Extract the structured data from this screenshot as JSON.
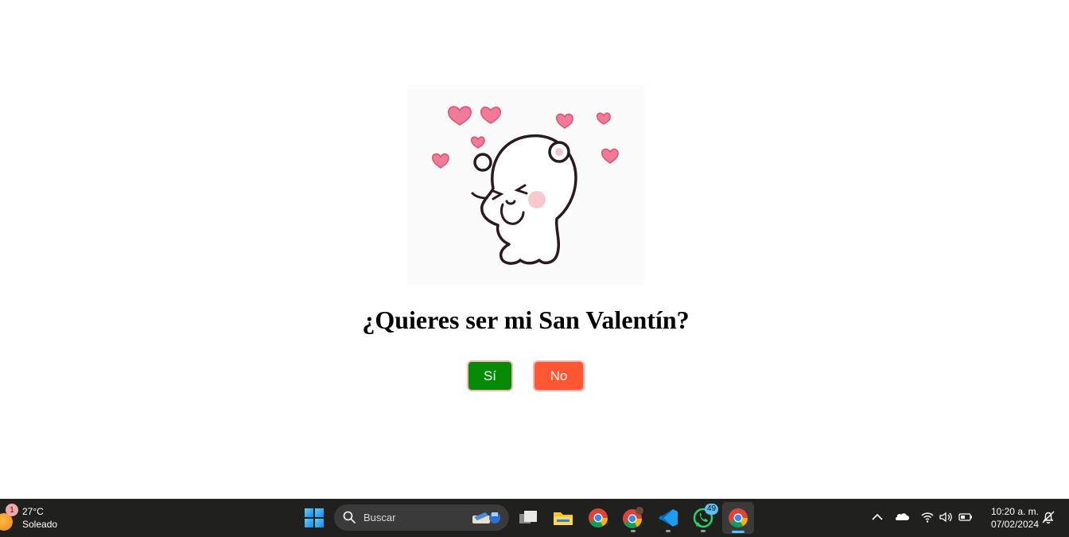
{
  "main": {
    "question": "¿Quieres ser mi San Valentín?",
    "yes_label": "Sí",
    "no_label": "No",
    "colors": {
      "yes": "#078b07",
      "no": "#ff5733"
    }
  },
  "taskbar": {
    "weather": {
      "badge": "1",
      "temp": "27°C",
      "condition": "Soleado"
    },
    "search_placeholder": "Buscar",
    "notification_count": "49",
    "time": "10:20 a. m.",
    "date": "07/02/2024",
    "icons": [
      "start-icon",
      "task-view-icon",
      "file-explorer-icon",
      "chrome-icon",
      "chrome-profile-icon",
      "vscode-icon",
      "whatsapp-icon",
      "chrome-active-icon"
    ],
    "tray": [
      "chevron-up-icon",
      "onedrive-icon",
      "wifi-icon",
      "volume-icon",
      "battery-icon",
      "notification-bell-icon"
    ]
  }
}
